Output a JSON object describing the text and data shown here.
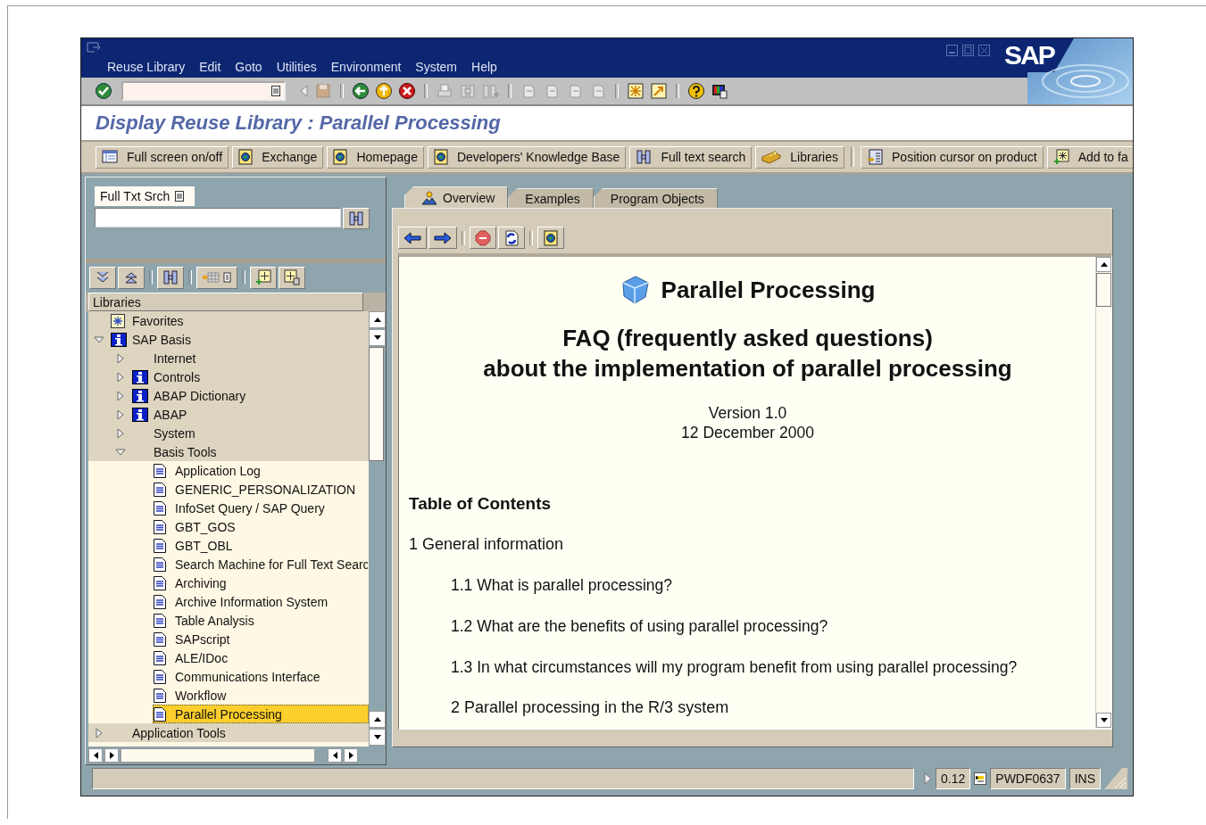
{
  "menu": [
    "Reuse Library",
    "Edit",
    "Goto",
    "Utilities",
    "Environment",
    "System",
    "Help"
  ],
  "logo": "SAP",
  "title": "Display Reuse Library : Parallel Processing",
  "app_toolbar": [
    [
      {
        "label": "Full screen on/off",
        "kind": "table"
      },
      {
        "label": "Exchange",
        "kind": "globe"
      },
      {
        "label": "Homepage",
        "kind": "globe"
      },
      {
        "label": "Developers' Knowledge Base",
        "kind": "globe"
      },
      {
        "label": "Full text search",
        "kind": "binoculars"
      },
      {
        "label": "Libraries",
        "kind": "box"
      }
    ],
    [
      {
        "label": "Position cursor on product",
        "kind": "cursor"
      },
      {
        "label": "Add to fa",
        "kind": "add"
      }
    ]
  ],
  "search": {
    "label": "Full Txt Srch"
  },
  "tree_header": "Libraries",
  "tree": [
    {
      "label": "Favorites",
      "kind": "favorites",
      "selected": false
    },
    {
      "label": "SAP Basis",
      "kind": "info",
      "expanded": true,
      "selected": false,
      "children": [
        {
          "label": "Internet",
          "kind": "folder",
          "expanded": false,
          "selected": false
        },
        {
          "label": "Controls",
          "kind": "info",
          "expanded": false,
          "selected": false
        },
        {
          "label": "ABAP Dictionary",
          "kind": "info",
          "expanded": false,
          "selected": false
        },
        {
          "label": "ABAP",
          "kind": "info",
          "expanded": false,
          "selected": false
        },
        {
          "label": "System",
          "kind": "folder",
          "expanded": false,
          "selected": false
        },
        {
          "label": "Basis Tools",
          "kind": "folder",
          "expanded": true,
          "selected": false,
          "children": [
            {
              "label": "Application Log",
              "kind": "doc",
              "selected": false
            },
            {
              "label": "GENERIC_PERSONALIZATION",
              "kind": "doc",
              "selected": false
            },
            {
              "label": "InfoSet Query / SAP Query",
              "kind": "doc",
              "selected": false
            },
            {
              "label": "GBT_GOS",
              "kind": "doc",
              "selected": false
            },
            {
              "label": "GBT_OBL",
              "kind": "doc",
              "selected": false
            },
            {
              "label": "Search Machine for Full Text Searc",
              "kind": "doc",
              "selected": false
            },
            {
              "label": "Archiving",
              "kind": "doc",
              "selected": false
            },
            {
              "label": "Archive Information System",
              "kind": "doc",
              "selected": false
            },
            {
              "label": "Table Analysis",
              "kind": "doc",
              "selected": false
            },
            {
              "label": "SAPscript",
              "kind": "doc",
              "selected": false
            },
            {
              "label": "ALE/IDoc",
              "kind": "doc",
              "selected": false
            },
            {
              "label": "Communications Interface",
              "kind": "doc",
              "selected": false
            },
            {
              "label": "Workflow",
              "kind": "doc",
              "selected": false
            },
            {
              "label": "Parallel Processing",
              "kind": "doc",
              "selected": true
            }
          ]
        }
      ]
    },
    {
      "label": "Application Tools",
      "kind": "folder",
      "expanded": false,
      "selected": false
    }
  ],
  "tabs": [
    {
      "label": "Overview",
      "selected": true
    },
    {
      "label": "Examples",
      "selected": false
    },
    {
      "label": "Program Objects",
      "selected": false
    }
  ],
  "document": {
    "title": "Parallel Processing",
    "subtitle": [
      "FAQ (frequently asked questions)",
      "about the implementation of parallel processing"
    ],
    "version": [
      "Version 1.0",
      "12 December 2000"
    ],
    "entries": [
      {
        "kind": "toc",
        "text": "Table of Contents"
      },
      {
        "kind": "section",
        "text": "1 General information"
      },
      {
        "kind": "item",
        "text": "1.1 What is parallel processing?"
      },
      {
        "kind": "item",
        "text": "1.2 What are the benefits of using parallel processing?"
      },
      {
        "kind": "item",
        "text": "1.3 In what circumstances will my program benefit from using parallel processing?"
      },
      {
        "kind": "subsection",
        "text": "2 Parallel processing in the R/3 system"
      }
    ]
  },
  "status_bar": [
    "0.12",
    "PWDF0637",
    "INS"
  ]
}
